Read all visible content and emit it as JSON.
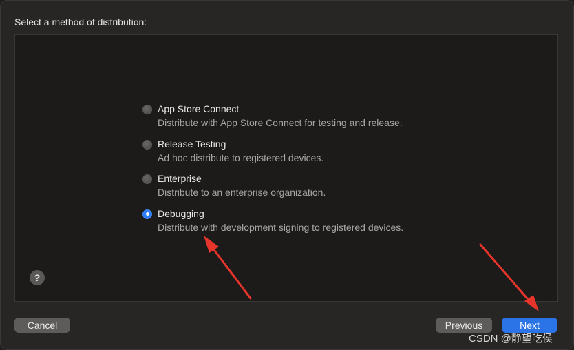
{
  "header": {
    "title": "Select a method of distribution:"
  },
  "options": [
    {
      "title": "App Store Connect",
      "description": "Distribute with App Store Connect for testing and release.",
      "selected": false
    },
    {
      "title": "Release Testing",
      "description": "Ad hoc distribute to registered devices.",
      "selected": false
    },
    {
      "title": "Enterprise",
      "description": "Distribute to an enterprise organization.",
      "selected": false
    },
    {
      "title": "Debugging",
      "description": "Distribute with development signing to registered devices.",
      "selected": true
    }
  ],
  "help": {
    "label": "?"
  },
  "footer": {
    "cancel_label": "Cancel",
    "previous_label": "Previous",
    "next_label": "Next"
  },
  "watermark": "CSDN @静望吃侯",
  "colors": {
    "accent": "#2f7df6",
    "annotation_arrow": "#e8352b"
  }
}
